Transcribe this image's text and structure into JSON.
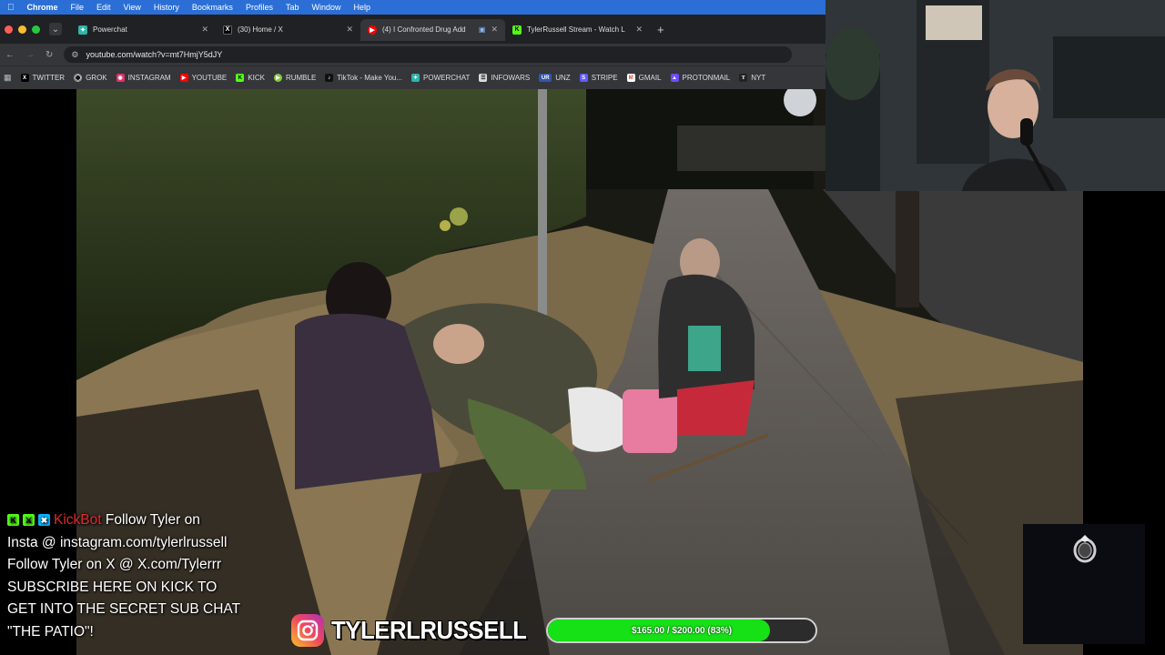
{
  "menubar": {
    "app": "Chrome",
    "items": [
      "File",
      "Edit",
      "View",
      "History",
      "Bookmarks",
      "Profiles",
      "Tab",
      "Window",
      "Help"
    ]
  },
  "tabs": [
    {
      "title": "Powerchat",
      "icon": "powerchat-icon",
      "color": "#2fb5a8"
    },
    {
      "title": "(30) Home / X",
      "icon": "x-icon",
      "color": "#000000"
    },
    {
      "title": "(4) I Confronted Drug Add",
      "icon": "youtube-icon",
      "color": "#ff0000",
      "active": true
    },
    {
      "title": "TylerRussell Stream - Watch L",
      "icon": "kick-icon",
      "color": "#53fc18"
    }
  ],
  "address": {
    "url": "youtube.com/watch?v=mt7HmjY5dJY"
  },
  "bookmarks": [
    {
      "label": "TWITTER",
      "icon": "x-icon",
      "color": "#000000"
    },
    {
      "label": "GROK",
      "icon": "grok-icon",
      "color": "#111111"
    },
    {
      "label": "INSTAGRAM",
      "icon": "instagram-icon",
      "color": "#e1306c"
    },
    {
      "label": "YOUTUBE",
      "icon": "youtube-icon",
      "color": "#ff0000"
    },
    {
      "label": "KICK",
      "icon": "kick-icon",
      "color": "#53fc18"
    },
    {
      "label": "RUMBLE",
      "icon": "rumble-icon",
      "color": "#85c742"
    },
    {
      "label": "TikTok - Make You...",
      "icon": "tiktok-icon",
      "color": "#111111"
    },
    {
      "label": "POWERCHAT",
      "icon": "powerchat-icon",
      "color": "#2fb5a8"
    },
    {
      "label": "INFOWARS",
      "icon": "infowars-icon",
      "color": "#dddddd"
    },
    {
      "label": "UNZ",
      "icon": "unz-icon",
      "color": "#3355aa"
    },
    {
      "label": "STRIPE",
      "icon": "stripe-icon",
      "color": "#635bff"
    },
    {
      "label": "GMAIL",
      "icon": "gmail-icon",
      "color": "#ea4335"
    },
    {
      "label": "PROTONMAIL",
      "icon": "protonmail-icon",
      "color": "#6d4aff"
    },
    {
      "label": "NYT",
      "icon": "nyt-icon",
      "color": "#222222"
    }
  ],
  "chat": {
    "username": "KickBot",
    "message_first": "Follow Tyler on",
    "lines": [
      "Insta @ instagram.com/tylerlrussell",
      "Follow Tyler on X @ X.com/Tylerrr",
      "SUBSCRIBE HERE ON KICK TO",
      "GET INTO THE SECRET SUB CHAT",
      "\"THE PATIO\"!"
    ]
  },
  "instagram": {
    "handle": "TYLERLRUSSELL"
  },
  "sub_goal": {
    "label": "$165.00 / $200.00 (83%)",
    "progress": 0.83,
    "color": "#16e016"
  }
}
